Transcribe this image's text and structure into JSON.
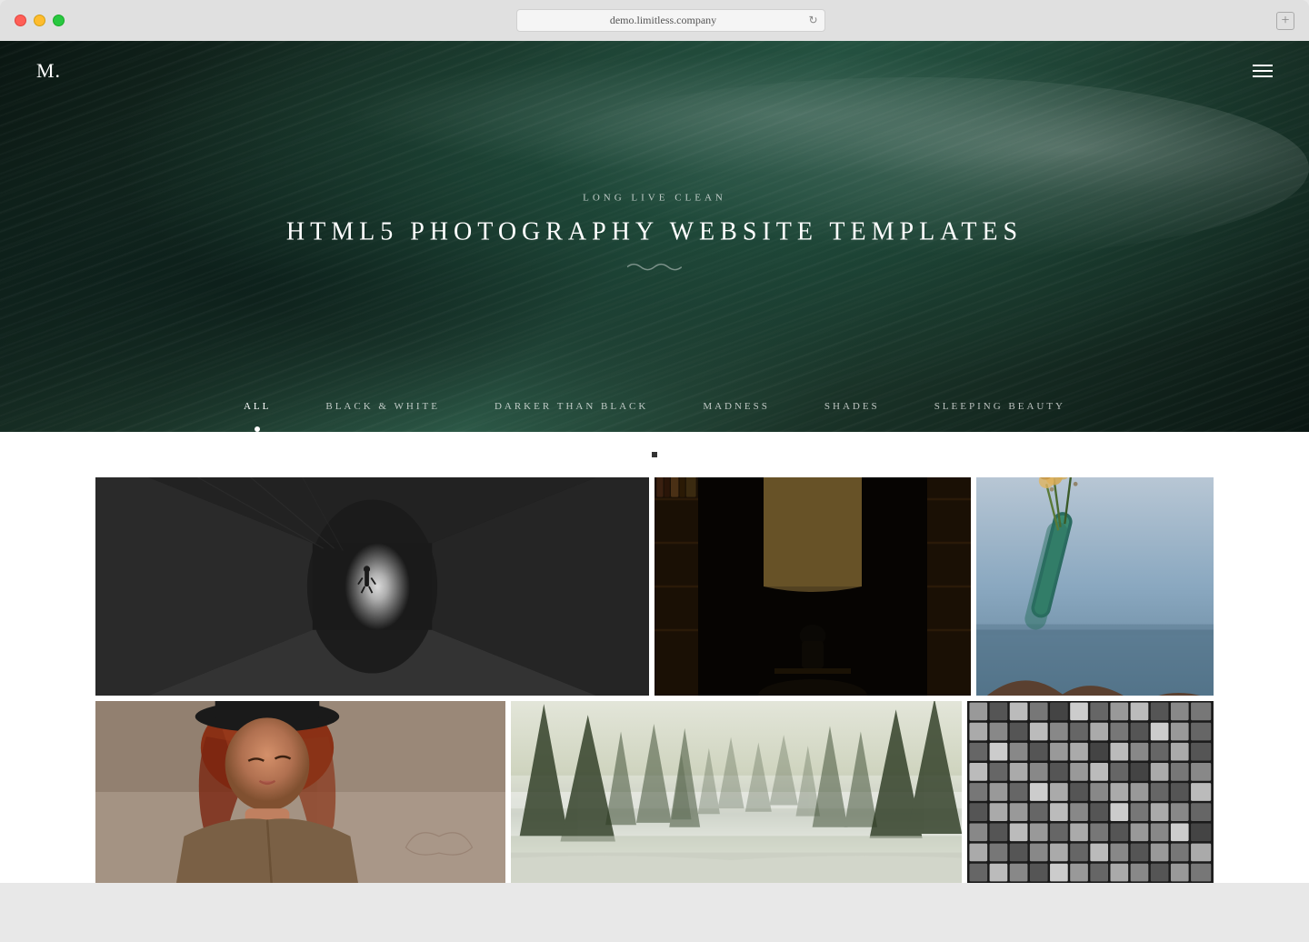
{
  "browser": {
    "url": "demo.limitless.company",
    "dots": [
      "red",
      "yellow",
      "green"
    ]
  },
  "nav": {
    "logo": "M.",
    "hamburger_label": "menu"
  },
  "hero": {
    "subtitle": "LONG LIVE CLEAN",
    "title": "HTML5 PHOTOGRAPHY WEBSITE TEMPLATES"
  },
  "filters": {
    "items": [
      {
        "label": "ALL",
        "active": true
      },
      {
        "label": "BLACK & WHITE",
        "active": false
      },
      {
        "label": "DARKER THAN BLACK",
        "active": false
      },
      {
        "label": "MADNESS",
        "active": false
      },
      {
        "label": "SHADES",
        "active": false
      },
      {
        "label": "SLEEPING BEAUTY",
        "active": false
      }
    ]
  },
  "gallery": {
    "row1": [
      {
        "id": "tunnel",
        "alt": "Dark tunnel with silhouette"
      },
      {
        "id": "library",
        "alt": "Dark library interior"
      },
      {
        "id": "flowers",
        "alt": "Hand holding flowers over ocean"
      }
    ],
    "row2": [
      {
        "id": "portrait",
        "alt": "Woman portrait with hat"
      },
      {
        "id": "forest",
        "alt": "Misty forest landscape"
      },
      {
        "id": "mosaic",
        "alt": "Mosaic tile pattern"
      }
    ]
  }
}
